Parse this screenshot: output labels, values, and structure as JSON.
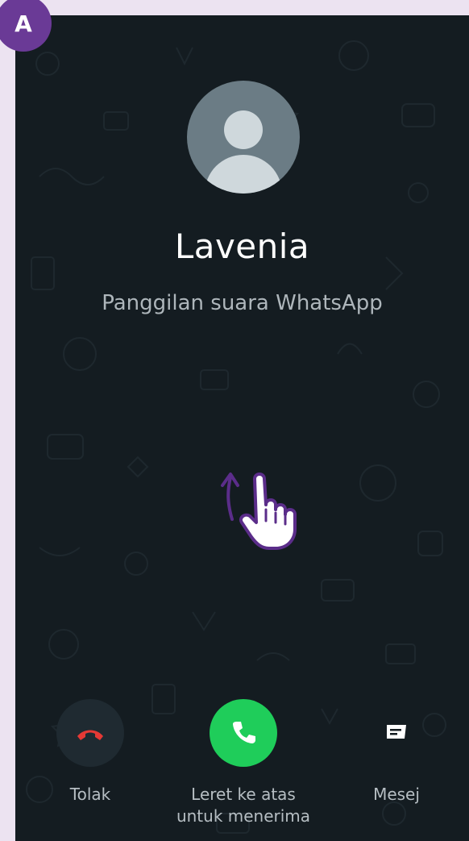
{
  "badge": {
    "letter": "A"
  },
  "caller": {
    "name": "Lavenia",
    "call_type": "Panggilan suara WhatsApp"
  },
  "actions": {
    "decline_label": "Tolak",
    "accept_label_line1": "Leret ke atas",
    "accept_label_line2": "untuk menerima",
    "message_label": "Mesej"
  },
  "icons": {
    "avatar": "person-avatar-icon",
    "decline": "phone-hangup-icon",
    "accept": "phone-icon",
    "message": "message-icon",
    "swipe": "hand-pointer-swipe-up-icon"
  },
  "colors": {
    "frame_background": "#ece3f1",
    "screen_background": "#141c21",
    "badge": "#6a3a96",
    "accept": "#1fcd5a",
    "decline_icon": "#e53935",
    "hint_purple": "#5b2d8a"
  }
}
